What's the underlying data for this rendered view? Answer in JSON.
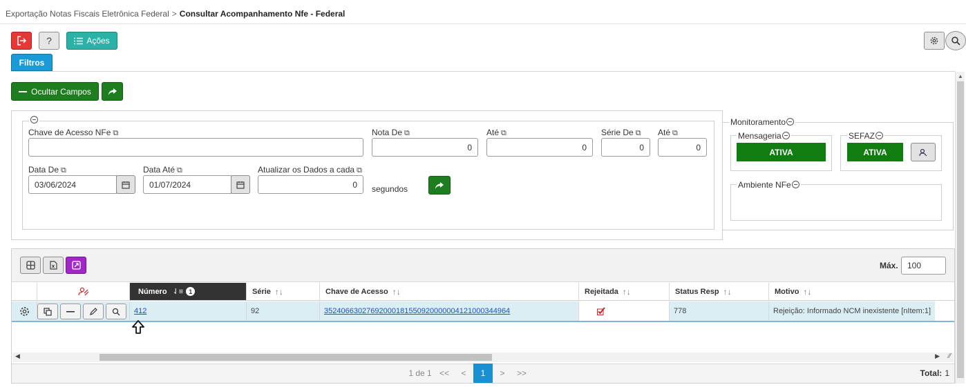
{
  "breadcrumb": {
    "parent": "Exportação Notas Fiscais Eletrônica Federal",
    "separator": ">",
    "current": "Consultar Acompanhamento Nfe - Federal"
  },
  "toolbar": {
    "help_label": "?",
    "actions_label": "Ações",
    "filters_tab": "Filtros"
  },
  "filters": {
    "hide_fields_label": "Ocultar Campos",
    "chave_label": "Chave de Acesso NFe",
    "chave_value": "",
    "nota_de_label": "Nota De",
    "nota_de_value": "0",
    "nota_ate_label": "Até",
    "nota_ate_value": "0",
    "serie_de_label": "Série De",
    "serie_de_value": "0",
    "serie_ate_label": "Até",
    "serie_ate_value": "0",
    "data_de_label": "Data De",
    "data_de_value": "03/06/2024",
    "data_ate_label": "Data Até",
    "data_ate_value": "01/07/2024",
    "atualizar_label": "Atualizar os Dados a cada",
    "atualizar_value": "0",
    "segundos_label": "segundos"
  },
  "monitoring": {
    "title": "Monitoramento",
    "mensageria_label": "Mensageria",
    "mensageria_status": "ATIVA",
    "sefaz_label": "SEFAZ",
    "sefaz_status": "ATIVA",
    "ambiente_label": "Ambiente NFe",
    "ambiente_value": "",
    "status_color": "#0f7d0f"
  },
  "grid": {
    "max_label": "Máx.",
    "max_value": "100",
    "columns": {
      "numero": "Número",
      "numero_badge": "1",
      "serie": "Série",
      "chave": "Chave de Acesso",
      "rejeitada": "Rejeitada",
      "status": "Status Resp",
      "motivo": "Motivo"
    },
    "rows": [
      {
        "numero": "412",
        "serie": "92",
        "chave": "35240663027692000181550920000004121000344964",
        "rejeitada": true,
        "status": "778",
        "motivo": "Rejeição: Informado NCM inexistente [nItem:1]"
      }
    ],
    "pager": {
      "info": "1 de 1",
      "first": "<<",
      "prev": "<",
      "current": "1",
      "next": ">",
      "last": ">>",
      "total_label": "Total:",
      "total_value": "1"
    }
  },
  "colors": {
    "exit_red": "#e53935",
    "teal": "#2bb1a6",
    "filter_blue": "#1a9bd7",
    "green": "#1e7d1e",
    "purple": "#a127c8",
    "row_highlight": "#daeef3",
    "header_dark": "#333333"
  },
  "icons": [
    "exit-icon",
    "help-icon",
    "list-icon",
    "gear-icon",
    "search-icon",
    "minus-icon",
    "share-arrow-icon",
    "copy-icon",
    "calendar-icon",
    "collapse-icon",
    "user-search-icon",
    "grid-icon",
    "excel-icon",
    "expand-icon",
    "remove-filter-icon",
    "sort-icon",
    "checkbox-checked-icon",
    "duplicate-icon",
    "edit-icon",
    "arrow-up-outline-icon"
  ]
}
